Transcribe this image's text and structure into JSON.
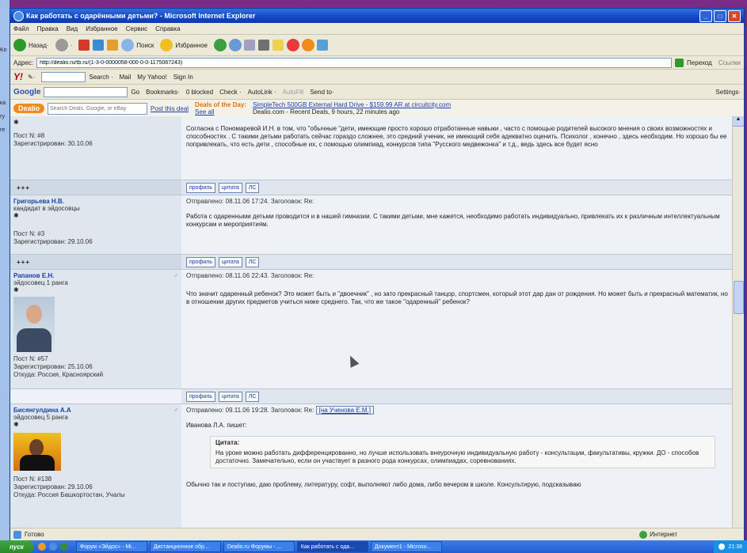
{
  "window": {
    "title": "Как работать с одарёнными детьми? - Microsoft Internet Explorer"
  },
  "menu": [
    "Файл",
    "Правка",
    "Вид",
    "Избранное",
    "Сервис",
    "Справка"
  ],
  "toolbar": {
    "back": "Назад",
    "search": "Поиск",
    "favorites": "Избранное"
  },
  "address": {
    "label": "Адрес:",
    "value": "http://dealio.ru/tb.ru/(1-3-0-0000058-000-0-0-1175067243)",
    "go": "Переход",
    "links": "Ссылки"
  },
  "yahoo_bar": {
    "logo": "Y!",
    "search_btn": "Search ·",
    "mail": "Mail",
    "my_yahoo": "My Yahoo!",
    "sign_in": "Sign In"
  },
  "google_bar": {
    "logo": "Google",
    "go": "Go",
    "bookmarks": "Bookmarks·",
    "blocked": "0 blocked",
    "check": "Check ·",
    "autolink": "AutoLink ·",
    "autofill": "AutoFill",
    "send_to": "Send to·",
    "settings": "Settings·"
  },
  "dealio": {
    "logo": "Dealio",
    "search_placeholder": "Search Deals, Google, or eBay",
    "post_deal": "Post this deal",
    "deals_label": "Deals of the Day:",
    "see_all": "See all",
    "deal_text": "SimpleTech 500GB External Hard Drive - $159.99 AR at circuitcity.com",
    "recent": "Dealio.com - Recent Deals, 9 hours, 22 minutes ago"
  },
  "posts": [
    {
      "author": "",
      "rank": "",
      "post_no": "Пост N: #8",
      "registered": "Зарегистрирован: 30.10.06",
      "location": "",
      "header": "",
      "body": "Согласна с Пономаревой И.Н. в том, что \"обычные \"дети, имеющие просто хорошо отработанные навыки , часто с помощью родителей высокого мнения о своих возможностях и способностях . С такими детьми работать сейчас гораздо сложнее, это средний ученик, не имеющий себя адекватно оценить. Психолог , конечно , здесь необходим. Но хорошо бы ее попривлекать, что есть дети , способные их, с помощью олимпиад, конкурсов типа \"Русского медвежонка\" и т.д., ведь здесь все будет ясно"
    },
    {
      "author": "Григорьева Н.В.",
      "rank": "кандидат в эйдосовцы",
      "post_no": "Пост N: #3",
      "registered": "Зарегистрирован: 29.10.06",
      "location": "",
      "header": "Отправлено: 08.11.06 17:24. Заголовок: Re:",
      "body": "Работа с одаренными детьми проводится и в нашей гимназии. С такими детьми, мне кажется, необходимо работать индивидуально, привлекать их к различным интеллектуальным конкурсам и мероприятиям."
    },
    {
      "author": "Рапанов Е.Н.",
      "rank": "эйдосовец 1 ранга",
      "post_no": "Пост N: #57",
      "registered": "Зарегистрирован: 25.10.06",
      "location": "Откуда: Россия, Красноярский",
      "header": "Отправлено: 08.11.06 22:43. Заголовок: Re:",
      "body": "Что значит одаренный ребенок? Это может быть и \"двоечник\" , но зато прекрасный танцор, спортсмен, который этот дар дан от рождения. Но может быть и прекрасный математик, но в отношении других предметов учиться ниже среднего. Так, что же такое \"одаренный\" ребенок?"
    },
    {
      "author": "Бисянгулдина А.А",
      "rank": "эйдосовец 5 ранга",
      "post_no": "Пост N: #138",
      "registered": "Зарегистрирован: 29.10.06",
      "location": "Откуда: Россия Башкортостан, Учалы",
      "header": "Отправлено: 09.11.06 19:28. Заголовок: Re:",
      "reply_to": "[на Ученова Е.М.]",
      "intro": "Иванова Л.А. пишет:",
      "quote_title": "Цитата:",
      "quote": "На уроке можно работать дифференцированно, но лучше использовать внеурочную индивидуальную работу - консультации, факультативы, кружки. ДО - способов достаточно. Замечательно, если он участвует в разного рода конкурсах, олимпиадах, соревнованиях.",
      "body": "Обычно так и поступаю, даю проблему, литературу, софт, выполняют либо дома, либо вечером в школе. Консультирую, подсказываю"
    }
  ],
  "actions": {
    "plus": "+++",
    "profile": "профиль",
    "quote": "цитата",
    "pm": "ЛС"
  },
  "status": {
    "left": "Готово",
    "zone": "Интернет"
  },
  "taskbar": {
    "start": "пуск",
    "tasks": [
      "Форум «Эйдос» - Mi...",
      "Дистанционное обр...",
      "Dealio.ru Форумы - ...",
      "Как работать с ода...",
      "Документ1 - Microso..."
    ],
    "active_task": 3,
    "clock": "21:38"
  },
  "desktop": {
    "items": [
      "Ko",
      "ка",
      "гу",
      "re"
    ]
  }
}
